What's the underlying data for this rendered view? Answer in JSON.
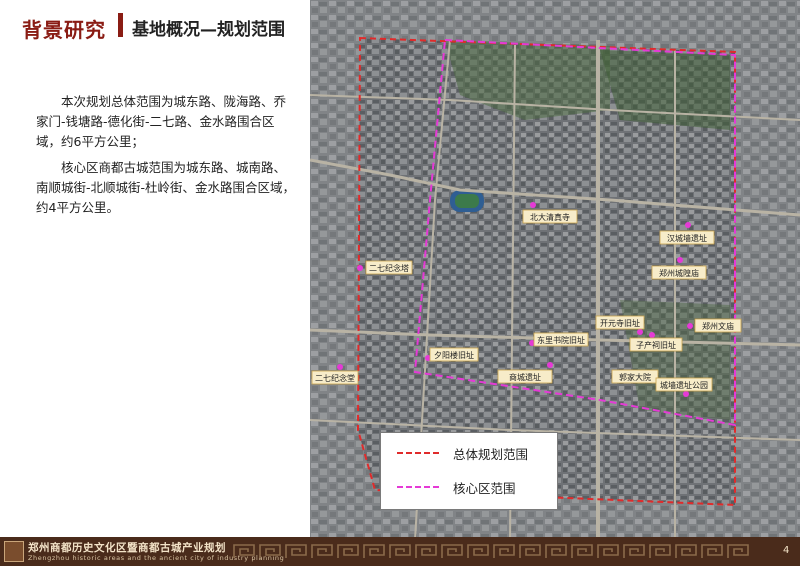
{
  "header": {
    "section": "背景研究",
    "subtitle": "基地概况—规划范围"
  },
  "body": {
    "paragraph1": "本次规划总体范围为城东路、陇海路、乔家门-钱塘路-德化街-二七路、金水路围合区域，约6平方公里；",
    "paragraph2": "核心区商都古城范围为城东路、城南路、南顺城街-北顺城街-杜岭街、金水路围合区域，约4平方公里。"
  },
  "map": {
    "places": [
      {
        "label": "北大清真寺"
      },
      {
        "label": "汉城墙遗址"
      },
      {
        "label": "郑州城隍庙"
      },
      {
        "label": "二七纪念塔"
      },
      {
        "label": "开元寺旧址"
      },
      {
        "label": "郑州文庙"
      },
      {
        "label": "子产祠旧址"
      },
      {
        "label": "东里书院旧址"
      },
      {
        "label": "夕阳楼旧址"
      },
      {
        "label": "二七纪念堂"
      },
      {
        "label": "商城遗址"
      },
      {
        "label": "郭家大院"
      },
      {
        "label": "城墙遗址公园"
      }
    ]
  },
  "legend": {
    "overall": {
      "label": "总体规划范围",
      "color": "#e02b2b"
    },
    "core": {
      "label": "核心区范围",
      "color": "#e53ad6"
    }
  },
  "footer": {
    "title": "郑州商都历史文化区暨商都古城产业规划",
    "english": "Zhengzhou historic areas and the ancient city of industry planning",
    "page": "4"
  }
}
